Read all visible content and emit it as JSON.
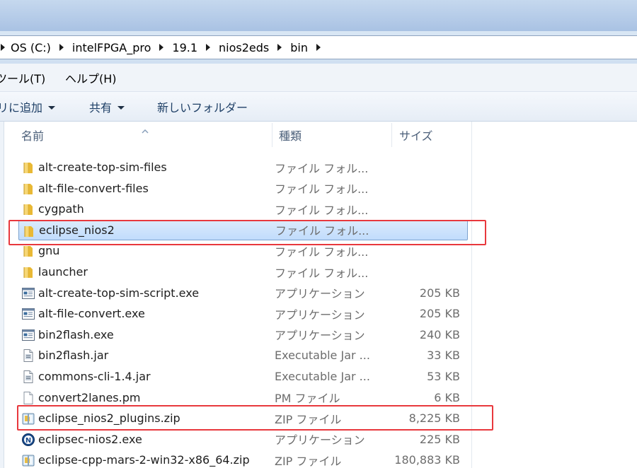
{
  "breadcrumb": {
    "segments": [
      "OS (C:)",
      "intelFPGA_pro",
      "19.1",
      "nios2eds",
      "bin"
    ]
  },
  "menu": {
    "items": [
      "ツール(T)",
      "ヘルプ(H)"
    ]
  },
  "toolbar": {
    "add_to_library": "リに追加",
    "share": "共有",
    "new_folder": "新しいフォルダー"
  },
  "columns": {
    "name": "名前",
    "type": "種類",
    "size": "サイズ"
  },
  "files": [
    {
      "name": "alt-create-top-sim-files",
      "type": "ファイル フォル...",
      "size": "",
      "icon": "folder-icon"
    },
    {
      "name": "alt-file-convert-files",
      "type": "ファイル フォル...",
      "size": "",
      "icon": "folder-icon"
    },
    {
      "name": "cygpath",
      "type": "ファイル フォル...",
      "size": "",
      "icon": "folder-icon"
    },
    {
      "name": "eclipse_nios2",
      "type": "ファイル フォル...",
      "size": "",
      "icon": "folder-icon"
    },
    {
      "name": "gnu",
      "type": "ファイル フォル...",
      "size": "",
      "icon": "folder-icon"
    },
    {
      "name": "launcher",
      "type": "ファイル フォル...",
      "size": "",
      "icon": "folder-icon"
    },
    {
      "name": "alt-create-top-sim-script.exe",
      "type": "アプリケーション",
      "size": "205 KB",
      "icon": "application-icon"
    },
    {
      "name": "alt-file-convert.exe",
      "type": "アプリケーション",
      "size": "205 KB",
      "icon": "application-icon"
    },
    {
      "name": "bin2flash.exe",
      "type": "アプリケーション",
      "size": "240 KB",
      "icon": "application-icon"
    },
    {
      "name": "bin2flash.jar",
      "type": "Executable Jar ...",
      "size": "33 KB",
      "icon": "jar-file-icon"
    },
    {
      "name": "commons-cli-1.4.jar",
      "type": "Executable Jar ...",
      "size": "53 KB",
      "icon": "jar-file-icon"
    },
    {
      "name": "convert2lanes.pm",
      "type": "PM ファイル",
      "size": "6 KB",
      "icon": "blank-file-icon"
    },
    {
      "name": "eclipse_nios2_plugins.zip",
      "type": "ZIP ファイル",
      "size": "8,225 KB",
      "icon": "zip-file-icon"
    },
    {
      "name": "eclipsec-nios2.exe",
      "type": "アプリケーション",
      "size": "225 KB",
      "icon": "nios-app-icon"
    },
    {
      "name": "eclipse-cpp-mars-2-win32-x86_64.zip",
      "type": "ZIP ファイル",
      "size": "180,883 KB",
      "icon": "zip-file-icon"
    }
  ],
  "selected_file": "eclipse_nios2",
  "highlighted_files": [
    "eclipse_nios2",
    "eclipse_nios2_plugins.zip"
  ],
  "colors": {
    "highlight_box": "#e8383d",
    "selection": "#c1dcfc",
    "folder": "#f2c64e"
  }
}
